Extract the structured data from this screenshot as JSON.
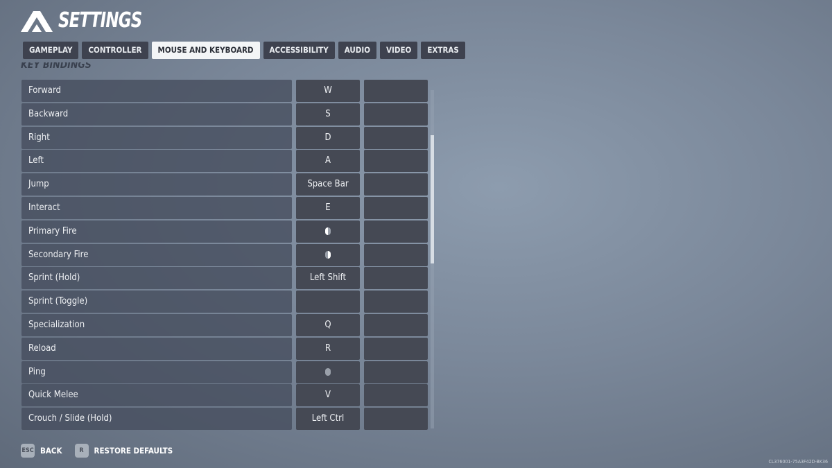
{
  "header": {
    "title": "SETTINGS",
    "logo_icon": "triangle-a-logo"
  },
  "tabs": [
    {
      "label": "GAMEPLAY"
    },
    {
      "label": "CONTROLLER"
    },
    {
      "label": "MOUSE AND KEYBOARD",
      "active": true
    },
    {
      "label": "ACCESSIBILITY"
    },
    {
      "label": "AUDIO"
    },
    {
      "label": "VIDEO"
    },
    {
      "label": "EXTRAS"
    }
  ],
  "section_title": "KEY BINDINGS",
  "bindings": [
    {
      "action": "Forward",
      "primary": "W",
      "secondary": ""
    },
    {
      "action": "Backward",
      "primary": "S",
      "secondary": ""
    },
    {
      "action": "Right",
      "primary": "D",
      "secondary": ""
    },
    {
      "action": "Left",
      "primary": "A",
      "secondary": ""
    },
    {
      "action": "Jump",
      "primary": "Space Bar",
      "secondary": ""
    },
    {
      "action": "Interact",
      "primary": "E",
      "secondary": ""
    },
    {
      "action": "Primary Fire",
      "primary_icon": "mouse-left-click-icon",
      "secondary": ""
    },
    {
      "action": "Secondary Fire",
      "primary_icon": "mouse-right-click-icon",
      "secondary": ""
    },
    {
      "action": "Sprint (Hold)",
      "primary": "Left Shift",
      "secondary": ""
    },
    {
      "action": "Sprint (Toggle)",
      "primary": "",
      "secondary": ""
    },
    {
      "action": "Specialization",
      "primary": "Q",
      "secondary": ""
    },
    {
      "action": "Reload",
      "primary": "R",
      "secondary": ""
    },
    {
      "action": "Ping",
      "primary_icon": "mouse-middle-click-icon",
      "secondary": ""
    },
    {
      "action": "Quick Melee",
      "primary": "V",
      "secondary": ""
    },
    {
      "action": "Crouch / Slide (Hold)",
      "primary": "Left Ctrl",
      "secondary": ""
    }
  ],
  "footer": {
    "back_key": "ESC",
    "back_label": "BACK",
    "restore_key": "R",
    "restore_label": "RESTORE DEFAULTS"
  },
  "version": "CL376001-75A3F42D-BK36"
}
